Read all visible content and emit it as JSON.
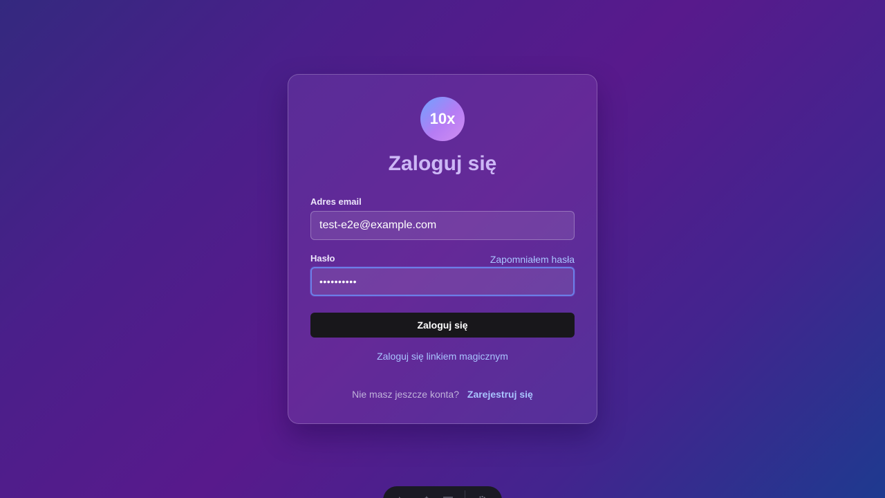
{
  "logo": {
    "text": "10x"
  },
  "login": {
    "title": "Zaloguj się",
    "email_label": "Adres email",
    "email_value": "test-e2e@example.com",
    "password_label": "Hasło",
    "forgot_link": "Zapomniałem hasła",
    "password_masked": "••••••••••",
    "submit_label": "Zaloguj się",
    "magic_link": "Zaloguj się linkiem magicznym",
    "no_account_text": "Nie masz jeszcze konta?",
    "signup_link": "Zarejestruj się"
  },
  "dock": {
    "icons": [
      "inspect-icon",
      "magic-icon",
      "menu-icon",
      "settings-icon"
    ]
  },
  "colors": {
    "link": "#a9c4ff",
    "button_bg": "#18171b",
    "focus_ring": "#6c7fe8"
  }
}
